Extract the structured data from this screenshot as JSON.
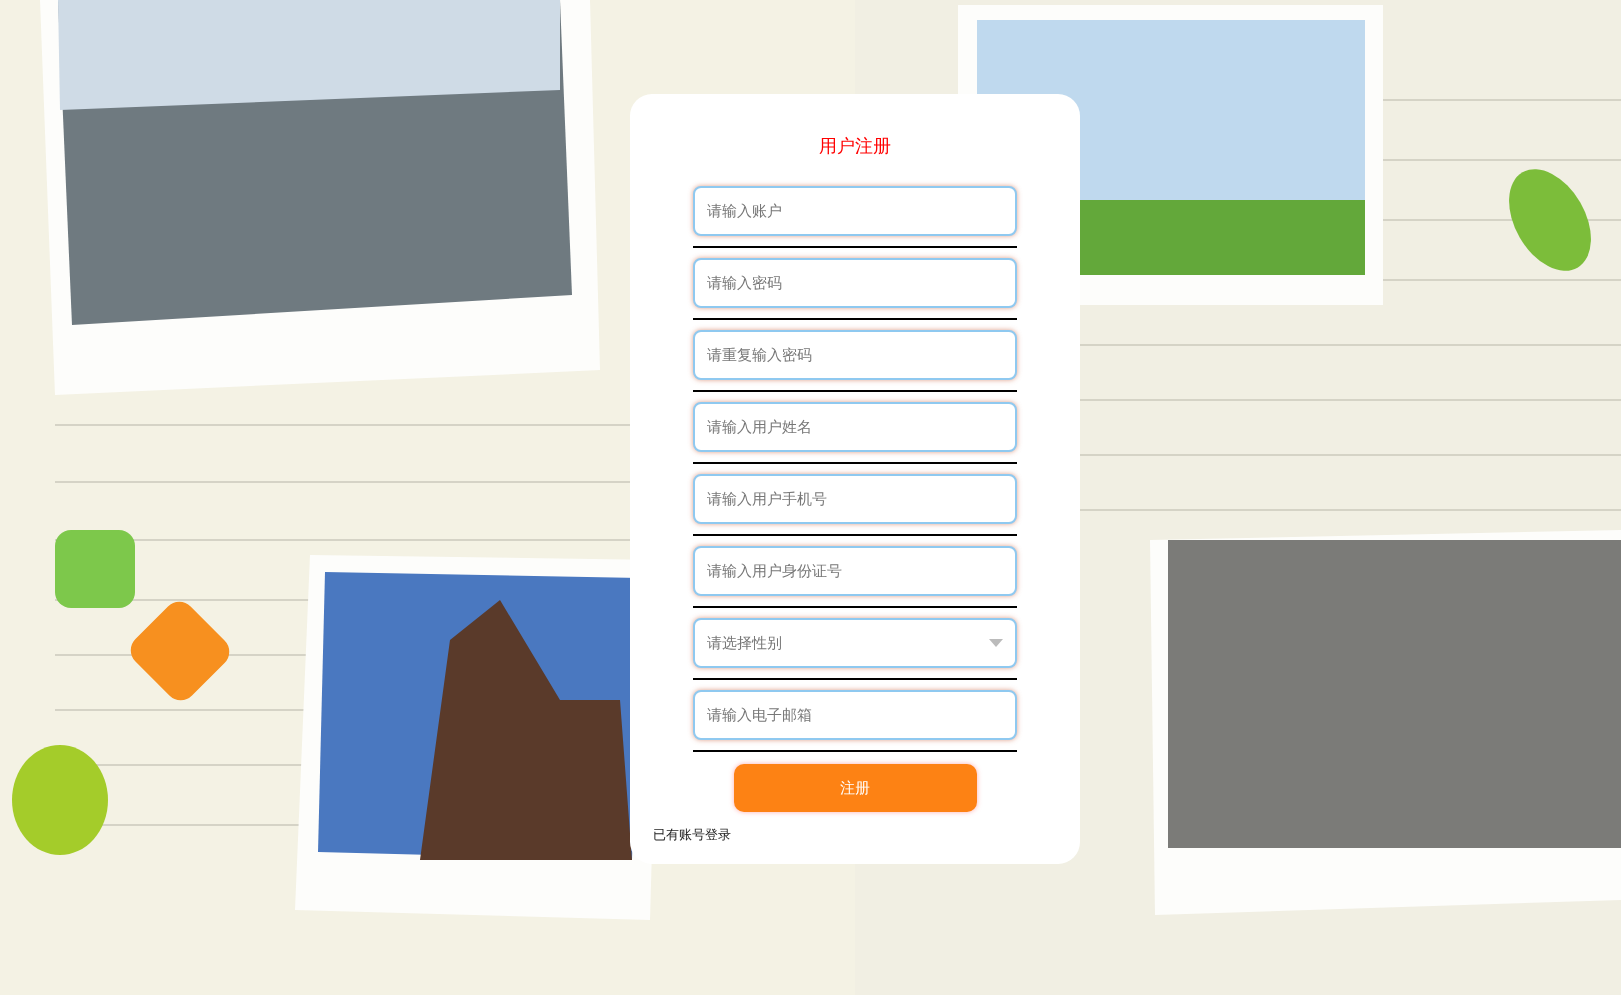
{
  "form": {
    "title": "用户注册",
    "fields": [
      {
        "kind": "text",
        "placeholder": "请输入账户"
      },
      {
        "kind": "text",
        "placeholder": "请输入密码"
      },
      {
        "kind": "text",
        "placeholder": "请重复输入密码"
      },
      {
        "kind": "text",
        "placeholder": "请输入用户姓名"
      },
      {
        "kind": "text",
        "placeholder": "请输入用户手机号"
      },
      {
        "kind": "text",
        "placeholder": "请输入用户身份证号"
      },
      {
        "kind": "select",
        "placeholder": "请选择性别"
      },
      {
        "kind": "text",
        "placeholder": "请输入电子邮箱"
      }
    ],
    "submit": "注册",
    "login_link": "已有账号登录"
  }
}
